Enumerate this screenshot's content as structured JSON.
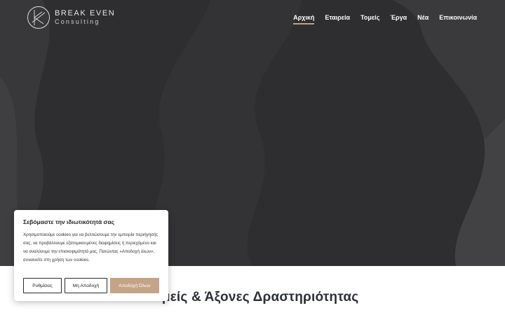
{
  "brand": {
    "name": "BREAK EVEN",
    "tagline": "Consulting"
  },
  "nav": {
    "items": [
      {
        "label": "Αρχική",
        "active": true
      },
      {
        "label": "Εταιρεία",
        "active": false
      },
      {
        "label": "Τομείς",
        "active": false
      },
      {
        "label": "Έργα",
        "active": false
      },
      {
        "label": "Νέα",
        "active": false
      },
      {
        "label": "Επικοινωνία",
        "active": false
      }
    ]
  },
  "section": {
    "title": "Τομείς & Άξονες Δραστηριότητας"
  },
  "cookie": {
    "title": "Σεβόμαστε την ιδιωτικότητά σας",
    "body": "Χρησιμοποιούμε cookies για να βελτιώσουμε την εμπειρία περιήγησής σας, να προβάλλουμε εξατομικευμένες διαφημίσεις ή περιεχόμενο και να αναλύουμε την επισκεψιμότητά μας. Πατώντας «Αποδοχή όλων», συναινείτε στη χρήση των cookies.",
    "settings_label": "Ρυθμίσεις",
    "reject_label": "Μη Αποδοχή",
    "accept_label": "Αποδοχή Όλων"
  },
  "colors": {
    "hero_bg": "#2e2e30",
    "accent": "#c4a486",
    "heading": "#2b2f38"
  }
}
